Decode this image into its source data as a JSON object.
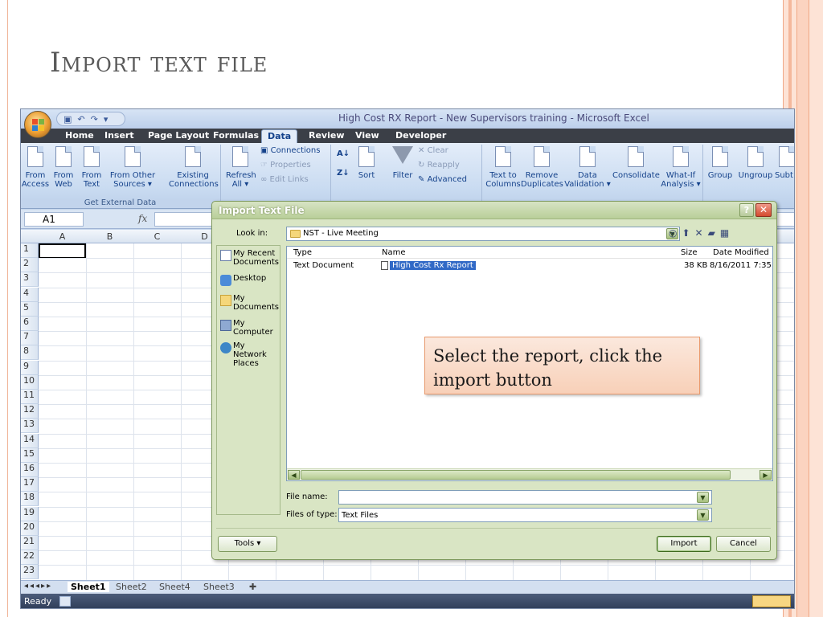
{
  "slide": {
    "title": "Import text file",
    "callout": "Select the report, click the import button"
  },
  "excel": {
    "window_title": "High Cost RX Report - New Supervisors training - Microsoft Excel",
    "tabs": [
      "Home",
      "Insert",
      "Page Layout",
      "Formulas",
      "Data",
      "Review",
      "View",
      "Developer"
    ],
    "active_tab": "Data",
    "ribbon": {
      "from_access": [
        "From",
        "Access"
      ],
      "from_web": [
        "From",
        "Web"
      ],
      "from_text": [
        "From",
        "Text"
      ],
      "from_other": [
        "From Other",
        "Sources ▾"
      ],
      "existing": [
        "Existing",
        "Connections"
      ],
      "get_external_data": "Get External Data",
      "refresh": [
        "Refresh",
        "All ▾"
      ],
      "connections": "Connections",
      "properties": "Properties",
      "edit_links": "Edit Links",
      "sort": "Sort",
      "filter": "Filter",
      "clear": "Clear",
      "reapply": "Reapply",
      "advanced": "Advanced",
      "text_to_columns": [
        "Text to",
        "Columns"
      ],
      "remove_duplicates": [
        "Remove",
        "Duplicates"
      ],
      "data_validation": [
        "Data",
        "Validation ▾"
      ],
      "consolidate": "Consolidate",
      "what_if": [
        "What-If",
        "Analysis ▾"
      ],
      "group": "Group",
      "ungroup": "Ungroup",
      "subtotal": "Subt"
    },
    "name_box": "A1",
    "fx": "fx",
    "columns": [
      "A",
      "B",
      "C",
      "D"
    ],
    "rows": [
      "1",
      "2",
      "3",
      "4",
      "5",
      "6",
      "7",
      "8",
      "9",
      "10",
      "11",
      "12",
      "13",
      "14",
      "15",
      "16",
      "17",
      "18",
      "19",
      "20",
      "21",
      "22",
      "23"
    ],
    "sheets": [
      "Sheet1",
      "Sheet2",
      "Sheet4",
      "Sheet3"
    ],
    "status": "Ready"
  },
  "dialog": {
    "title": "Import Text File",
    "look_in_label": "Look in:",
    "look_in_value": "NST - Live Meeting",
    "places": [
      "My Recent Documents",
      "Desktop",
      "My Documents",
      "My Computer",
      "My Network Places"
    ],
    "columns": {
      "type": "Type",
      "name": "Name",
      "size": "Size",
      "date": "Date Modified"
    },
    "files": [
      {
        "type": "Text Document",
        "name": "High Cost Rx Report",
        "size": "38 KB",
        "date": "8/16/2011 7:35"
      }
    ],
    "file_name_label": "File name:",
    "file_name_value": "",
    "files_of_type_label": "Files of type:",
    "files_of_type_value": "Text Files",
    "tools": "Tools",
    "import": "Import",
    "cancel": "Cancel"
  }
}
